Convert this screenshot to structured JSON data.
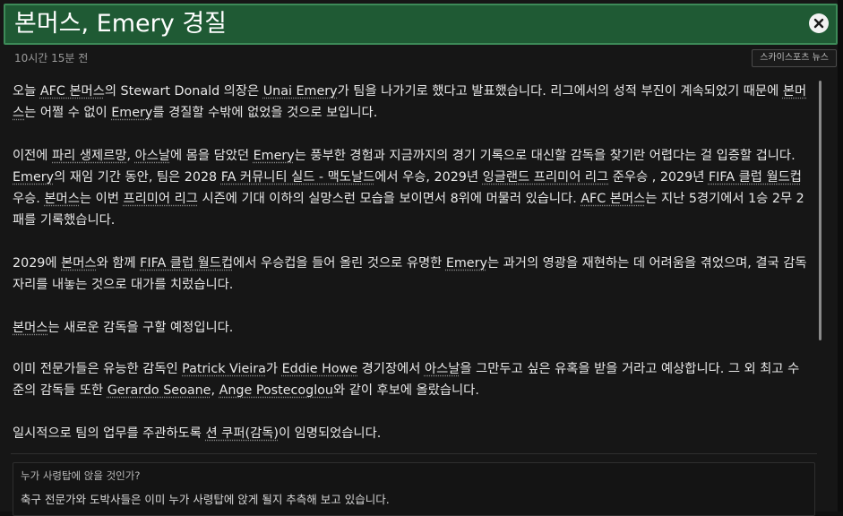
{
  "header": {
    "title": "본머스, Emery 경질",
    "close_icon": "close-icon"
  },
  "meta": {
    "timestamp": "10시간 15분 전",
    "source_label": "스카이스포츠 뉴스"
  },
  "article": {
    "paragraphs": [
      [
        {
          "t": "오늘 "
        },
        {
          "t": "AFC 본머스",
          "link": true
        },
        {
          "t": "의 Stewart Donald 의장은 "
        },
        {
          "t": "Unai Emery",
          "link": true
        },
        {
          "t": "가 팀을 나가기로 했다고 발표했습니다. 리그에서의 성적 부진이 계속되었기 때문에 "
        },
        {
          "t": "본머스",
          "link": true
        },
        {
          "t": "는 어쩔 수 없이 "
        },
        {
          "t": "Emery",
          "link": true
        },
        {
          "t": "를 경질할 수밖에 없었을 것으로 보입니다."
        }
      ],
      [
        {
          "t": "이전에 "
        },
        {
          "t": "파리 생제르망",
          "link": true
        },
        {
          "t": ", "
        },
        {
          "t": "아스날",
          "link": true
        },
        {
          "t": "에 몸을 담았던 "
        },
        {
          "t": "Emery",
          "link": true
        },
        {
          "t": "는 풍부한 경험과 지금까지의 경기 기록으로 대신할 감독을 찾기란 어렵다는 걸 입증할 겁니다. "
        },
        {
          "t": "Emery",
          "link": true
        },
        {
          "t": "의 재임 기간 동안, 팀은 2028 "
        },
        {
          "t": "FA 커뮤니티 실드 - 맥도날드",
          "link": true
        },
        {
          "t": "에서 우승, 2029년 "
        },
        {
          "t": "잉글랜드 프리미어 리그",
          "link": true
        },
        {
          "t": " 준우승 , 2029년 "
        },
        {
          "t": "FIFA 클럽 월드컵",
          "link": true
        },
        {
          "t": " 우승. "
        },
        {
          "t": "본머스",
          "link": true
        },
        {
          "t": "는 이번 "
        },
        {
          "t": "프리미어 리그",
          "link": true
        },
        {
          "t": " 시즌에 기대 이하의 실망스런 모습을 보이면서 8위에 머물러 있습니다. "
        },
        {
          "t": "AFC 본머스",
          "link": true
        },
        {
          "t": "는 지난 5경기에서 1승 2무 2패를 기록했습니다."
        }
      ],
      [
        {
          "t": "2029에 "
        },
        {
          "t": "본머스",
          "link": true
        },
        {
          "t": "와 함께 "
        },
        {
          "t": "FIFA 클럽 월드컵",
          "link": true
        },
        {
          "t": "에서 우승컵을 들어 올린 것으로 유명한 "
        },
        {
          "t": "Emery",
          "link": true
        },
        {
          "t": "는 과거의 영광을 재현하는 데 어려움을 겪었으며, 결국 감독 자리를 내놓는 것으로 대가를 치렀습니다."
        }
      ],
      [
        {
          "t": "본머스",
          "link": true
        },
        {
          "t": "는 새로운 감독을 구할 예정입니다."
        }
      ],
      [
        {
          "t": "이미 전문가들은 유능한 감독인 "
        },
        {
          "t": "Patrick Vieira",
          "link": true
        },
        {
          "t": "가 "
        },
        {
          "t": "Eddie Howe",
          "link": true
        },
        {
          "t": " 경기장에서 "
        },
        {
          "t": "아스날",
          "link": true
        },
        {
          "t": "을 그만두고 싶은 유혹을 받을 거라고 예상합니다.  그 외 최고 수준의 감독들 또한 "
        },
        {
          "t": "Gerardo Seoane",
          "link": true
        },
        {
          "t": ", "
        },
        {
          "t": "Ange Postecoglou",
          "link": true
        },
        {
          "t": "와 같이 후보에 올랐습니다."
        }
      ],
      [
        {
          "t": "일시적으로 팀의 업무를 주관하도록 "
        },
        {
          "t": "션 쿠퍼(감독)",
          "link": true
        },
        {
          "t": "이 임명되었습니다."
        }
      ]
    ]
  },
  "question": {
    "title": "누가 사령탑에 앉을 것인가?",
    "body": "축구 전문가와 도박사들은 이미 누가 사령탑에 앉게 될지 추측해 보고 있습니다."
  },
  "colors": {
    "title_bar_bg": "#1f5a34",
    "title_bar_border": "#3d8a58",
    "background": "#161616",
    "text": "#e8e8e8"
  }
}
